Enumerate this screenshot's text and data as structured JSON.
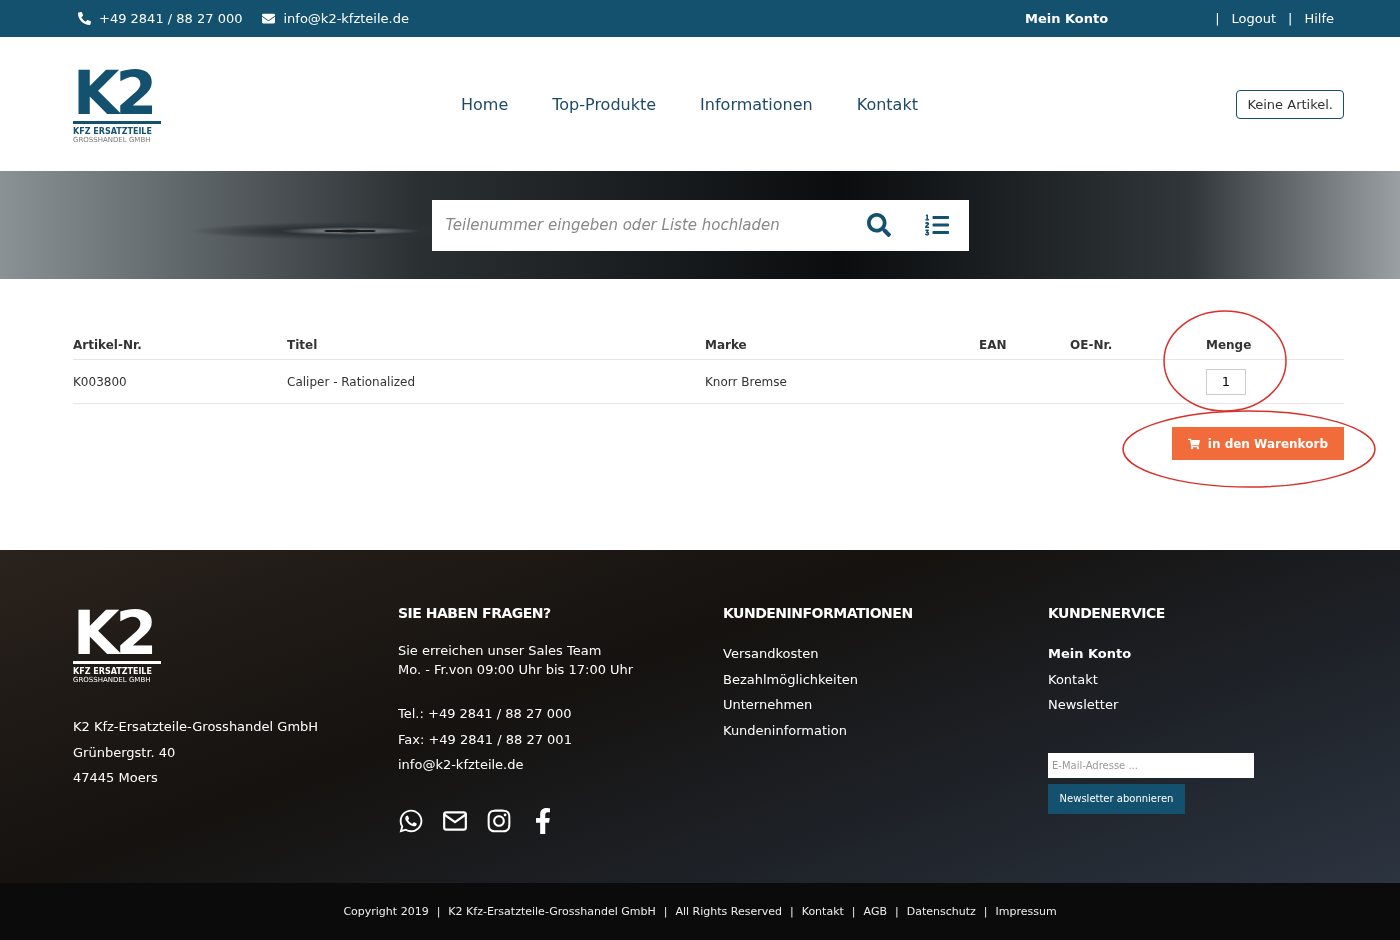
{
  "topbar": {
    "phone": "+49 2841 / 88 27 000",
    "email": "info@k2-kfzteile.de",
    "account": "Mein Konto",
    "links": [
      {
        "separator": "|",
        "label": "Logout"
      },
      {
        "separator": "|",
        "label": "Hilfe"
      }
    ]
  },
  "logo": {
    "mark": "K2",
    "line1": "KFZ ERSATZTEILE",
    "line2": "GROSSHANDEL GMBH"
  },
  "nav": [
    "Home",
    "Top-Produkte",
    "Informationen",
    "Kontakt"
  ],
  "cart_button": "Keine Artikel.",
  "search": {
    "placeholder": "Teilenummer eingeben oder Liste hochladen"
  },
  "table": {
    "columns": [
      "Artikel-Nr.",
      "Titel",
      "Marke",
      "EAN",
      "OE-Nr.",
      "Menge"
    ],
    "rows": [
      {
        "article": "K003800",
        "title": "Caliper - Rationalized",
        "brand": "Knorr Bremse",
        "ean_value": "",
        "oe": "",
        "quantity": "1"
      }
    ]
  },
  "add_to_cart": "in den Warenkorb",
  "footer": {
    "logo": {
      "mark": "K2",
      "line1": "KFZ ERSATZTEILE",
      "line2": "GROSSHANDEL GMBH"
    },
    "address": [
      "K2 Kfz-Ersatzteile-Grosshandel GmbH",
      "Grünbergstr. 40",
      "47445 Moers"
    ],
    "contact": {
      "title": "SIE HABEN FRAGEN?",
      "hours": [
        "Sie erreichen unser Sales Team",
        "Mo. - Fr.von 09:00 Uhr bis 17:00 Uhr"
      ],
      "lines": [
        "Tel.: +49 2841 / 88 27 000",
        "Fax: +49 2841 / 88 27 001",
        "info@k2-kfzteile.de"
      ]
    },
    "info": {
      "title": "KUNDENINFORMATIONEN",
      "links": [
        "Versandkosten",
        "Bezahlmöglichkeiten",
        "Unternehmen",
        "Kundeninformation"
      ]
    },
    "service": {
      "title": "KUNDENERVICE",
      "links": [
        {
          "label": "Mein Konto",
          "selected": true
        },
        {
          "label": "Kontakt",
          "selected": false
        },
        {
          "label": "Newsletter",
          "selected": false
        }
      ],
      "newsletter_placeholder": "E-Mail-Adresse ...",
      "newsletter_button": "Newsletter abonnieren"
    }
  },
  "bottom": [
    {
      "label": "Copyright 2019"
    },
    {
      "separator": "|",
      "label": "K2 Kfz-Ersatzteile-Grosshandel GmbH"
    },
    {
      "separator": "|",
      "label": "All Rights Reserved"
    },
    {
      "separator": "|",
      "label": "Kontakt"
    },
    {
      "separator": "|",
      "label": "AGB"
    },
    {
      "separator": "|",
      "label": "Datenschutz"
    },
    {
      "separator": "|",
      "label": "Impressum"
    }
  ]
}
